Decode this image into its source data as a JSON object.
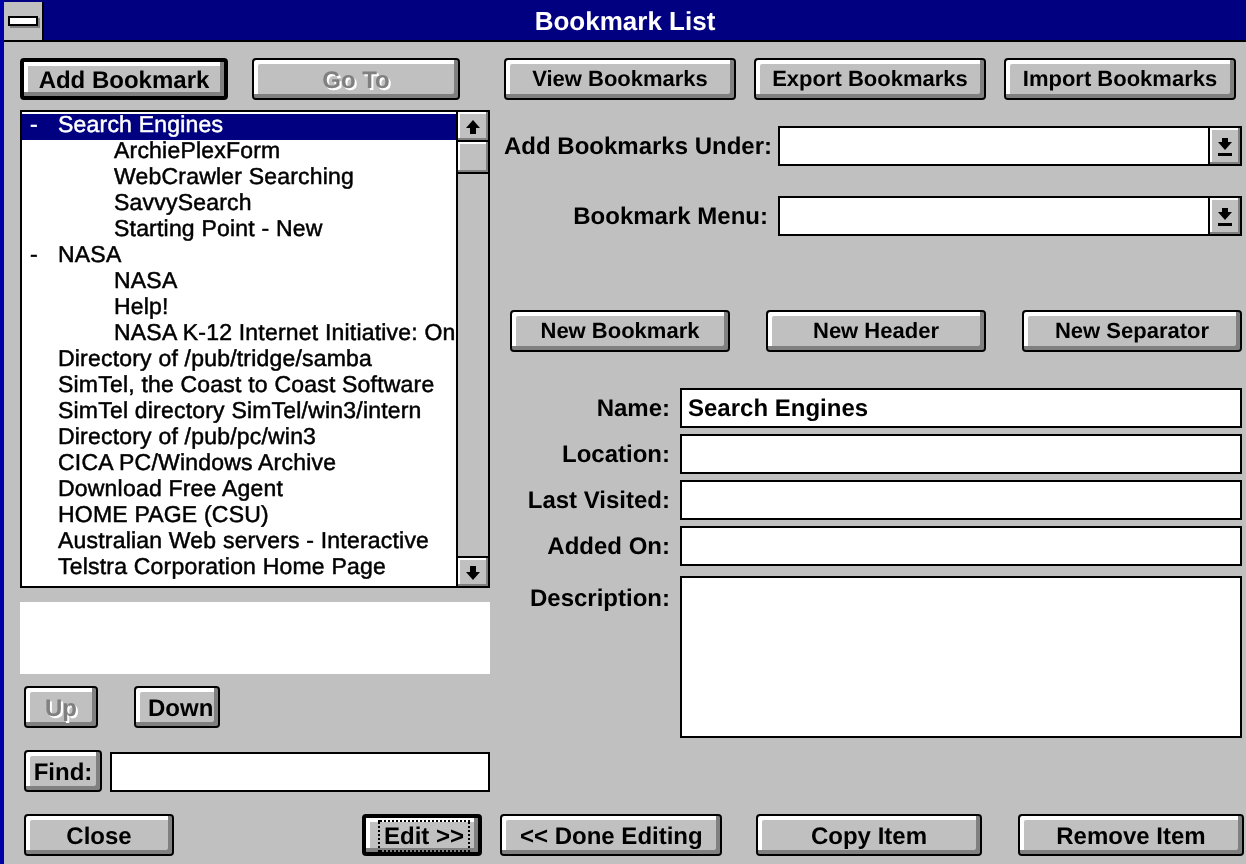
{
  "window": {
    "title": "Bookmark List"
  },
  "left_buttons": [
    {
      "label": "Add Bookmark",
      "disabled": false,
      "default": true
    },
    {
      "label": "Go To",
      "disabled": true,
      "default": false
    }
  ],
  "tree": [
    {
      "toggle": "-",
      "label": "Search Engines",
      "selected": true,
      "children": [
        {
          "label": "ArchiePlexForm",
          "selected": false
        },
        {
          "label": "WebCrawler Searching",
          "selected": false
        },
        {
          "label": "SavvySearch",
          "selected": false
        },
        {
          "label": "Starting Point - New",
          "selected": false
        }
      ]
    },
    {
      "toggle": "-",
      "label": "NASA",
      "selected": false,
      "children": [
        {
          "label": "NASA",
          "selected": false
        },
        {
          "label": "Help!",
          "selected": false
        },
        {
          "label": "NASA K-12 Internet Initiative: On",
          "selected": false
        }
      ]
    },
    {
      "label": "Directory of /pub/tridge/samba",
      "selected": false
    },
    {
      "label": "SimTel, the Coast to Coast Software",
      "selected": false
    },
    {
      "label": "SimTel directory SimTel/win3/intern",
      "selected": false
    },
    {
      "label": "Directory of /pub/pc/win3",
      "selected": false
    },
    {
      "label": "CICA PC/Windows Archive",
      "selected": false
    },
    {
      "label": "Download Free Agent",
      "selected": false
    },
    {
      "label": "HOME PAGE (CSU)",
      "selected": false
    },
    {
      "label": "Australian Web servers - Interactive",
      "selected": false
    },
    {
      "label": "Telstra Corporation Home Page",
      "selected": false
    }
  ],
  "move_buttons": [
    {
      "label": "Up",
      "disabled": true
    },
    {
      "label": "Down",
      "disabled": false
    }
  ],
  "find": {
    "label": "Find:"
  },
  "top_buttons": [
    "View Bookmarks",
    "Export Bookmarks",
    "Import Bookmarks"
  ],
  "combos": [
    {
      "label": "Add Bookmarks Under:"
    },
    {
      "label": "Bookmark Menu:"
    }
  ],
  "new_buttons": [
    "New Bookmark",
    "New Header",
    "New Separator"
  ],
  "fields": [
    {
      "label": "Name:",
      "value": "Search Engines"
    },
    {
      "label": "Location:"
    },
    {
      "label": "Last Visited:"
    },
    {
      "label": "Added On:"
    }
  ],
  "description": {
    "label": "Description:"
  },
  "bottom_buttons": [
    {
      "label": "Close",
      "focused": false
    },
    {
      "label": "Edit >>",
      "focused": true
    },
    {
      "label": "<< Done Editing",
      "focused": false
    },
    {
      "label": "Copy Item",
      "focused": false
    },
    {
      "label": "Remove Item",
      "focused": false
    }
  ]
}
